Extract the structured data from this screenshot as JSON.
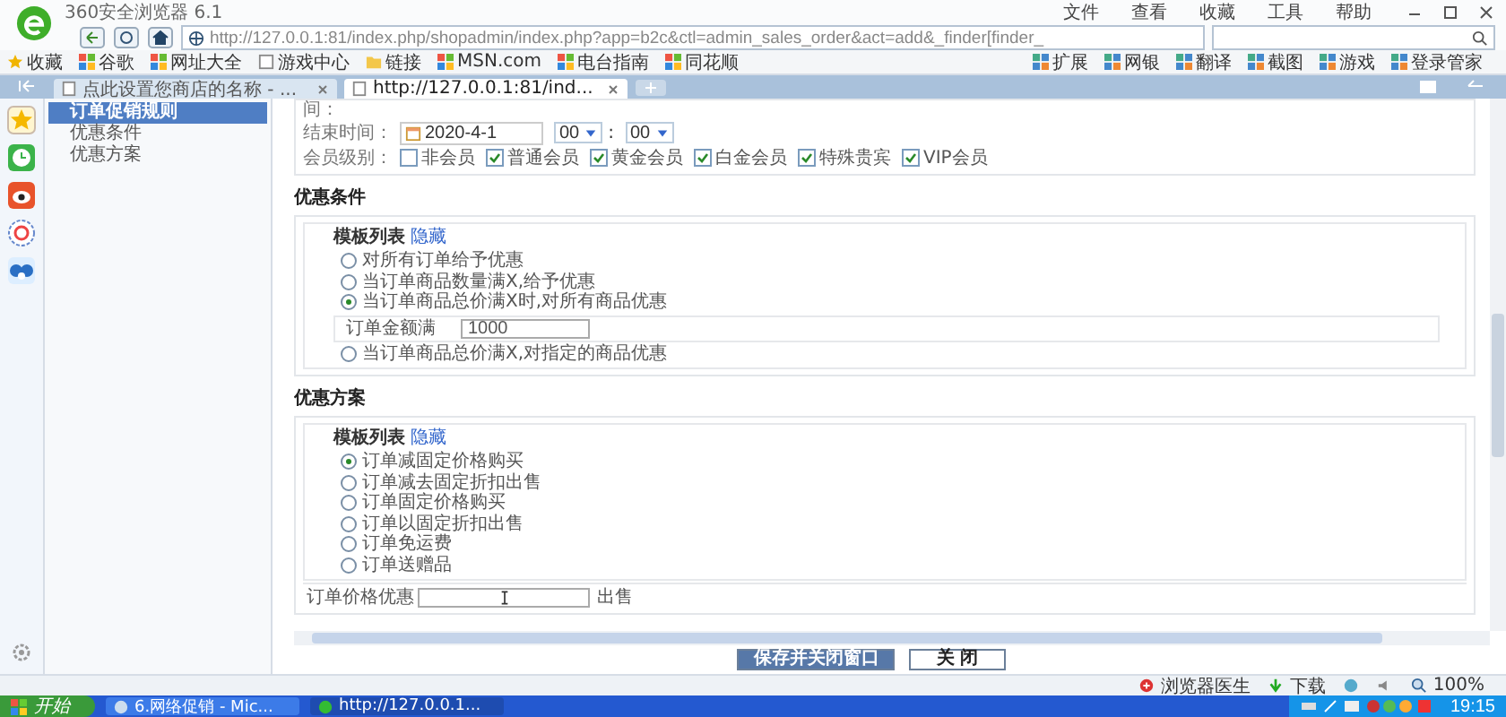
{
  "browser": {
    "title": "360安全浏览器 6.1",
    "menu": [
      "文件",
      "查看",
      "收藏",
      "工具",
      "帮助"
    ],
    "address": "http://127.0.0.1:81/index.php/shopadmin/index.php?app=b2c&ctl=admin_sales_order&act=add&_finder[finder_",
    "bookmarks_left": [
      {
        "label": "收藏",
        "kind": "menu"
      },
      {
        "label": "谷歌",
        "kind": "link"
      },
      {
        "label": "网址大全",
        "kind": "link"
      },
      {
        "label": "游戏中心",
        "kind": "page"
      },
      {
        "label": "链接",
        "kind": "folder"
      },
      {
        "label": "MSN.com",
        "kind": "link"
      },
      {
        "label": "电台指南",
        "kind": "link"
      },
      {
        "label": "同花顺",
        "kind": "link"
      }
    ],
    "bookmarks_right": [
      "扩展",
      "网银",
      "翻译",
      "截图",
      "游戏",
      "登录管家"
    ],
    "tabs": [
      {
        "label": "点此设置您商店的名称 - ...",
        "selected": false
      },
      {
        "label": "http://127.0.0.1:81/ind...",
        "selected": true
      }
    ]
  },
  "sidebar": {
    "items": [
      {
        "label": "订单促销规则",
        "selected": true
      },
      {
        "label": "优惠条件",
        "selected": false
      },
      {
        "label": "优惠方案",
        "selected": false
      }
    ]
  },
  "form": {
    "cut_label": "间：",
    "end_time": {
      "label": "结束时间：",
      "date": "2020-4-1",
      "hour": "00",
      "separator": ":",
      "minute": "00"
    },
    "member_level": {
      "label": "会员级别：",
      "options": [
        {
          "label": "非会员",
          "checked": false
        },
        {
          "label": "普通会员",
          "checked": true
        },
        {
          "label": "黄金会员",
          "checked": true
        },
        {
          "label": "白金会员",
          "checked": true
        },
        {
          "label": "特殊贵宾",
          "checked": true
        },
        {
          "label": "VIP会员",
          "checked": true
        }
      ]
    }
  },
  "conditions": {
    "heading": "优惠条件",
    "template_label": "模板列表",
    "toggle_link": "隐藏",
    "options": [
      {
        "label": "对所有订单给予优惠",
        "selected": false
      },
      {
        "label": "当订单商品数量满X,给予优惠",
        "selected": false
      },
      {
        "label": "当订单商品总价满X时,对所有商品优惠",
        "selected": true,
        "field": {
          "label": "订单金额满",
          "value": "1000"
        }
      },
      {
        "label": "当订单商品总价满X,对指定的商品优惠",
        "selected": false
      }
    ]
  },
  "plans": {
    "heading": "优惠方案",
    "template_label": "模板列表",
    "toggle_link": "隐藏",
    "options": [
      {
        "label": "订单减固定价格购买",
        "selected": true
      },
      {
        "label": "订单减去固定折扣出售",
        "selected": false
      },
      {
        "label": "订单固定价格购买",
        "selected": false
      },
      {
        "label": "订单以固定折扣出售",
        "selected": false
      },
      {
        "label": "订单免运费",
        "selected": false
      },
      {
        "label": "订单送赠品",
        "selected": false
      }
    ],
    "price_field": {
      "label": "订单价格优惠",
      "suffix": "出售"
    }
  },
  "buttons": [
    {
      "label": "保存并关闭窗口",
      "kind": "primary"
    },
    {
      "label": "关 闭",
      "kind": "default"
    }
  ],
  "status_bar": {
    "doctor": "浏览器医生",
    "download": "下载",
    "zoom": "100%"
  },
  "taskbar": {
    "start": "开始",
    "tasks": [
      {
        "label": "6.网络促销 - Mic...",
        "selected": false
      },
      {
        "label": "http://127.0.0.1...",
        "selected": true
      }
    ],
    "clock": "19:15"
  }
}
